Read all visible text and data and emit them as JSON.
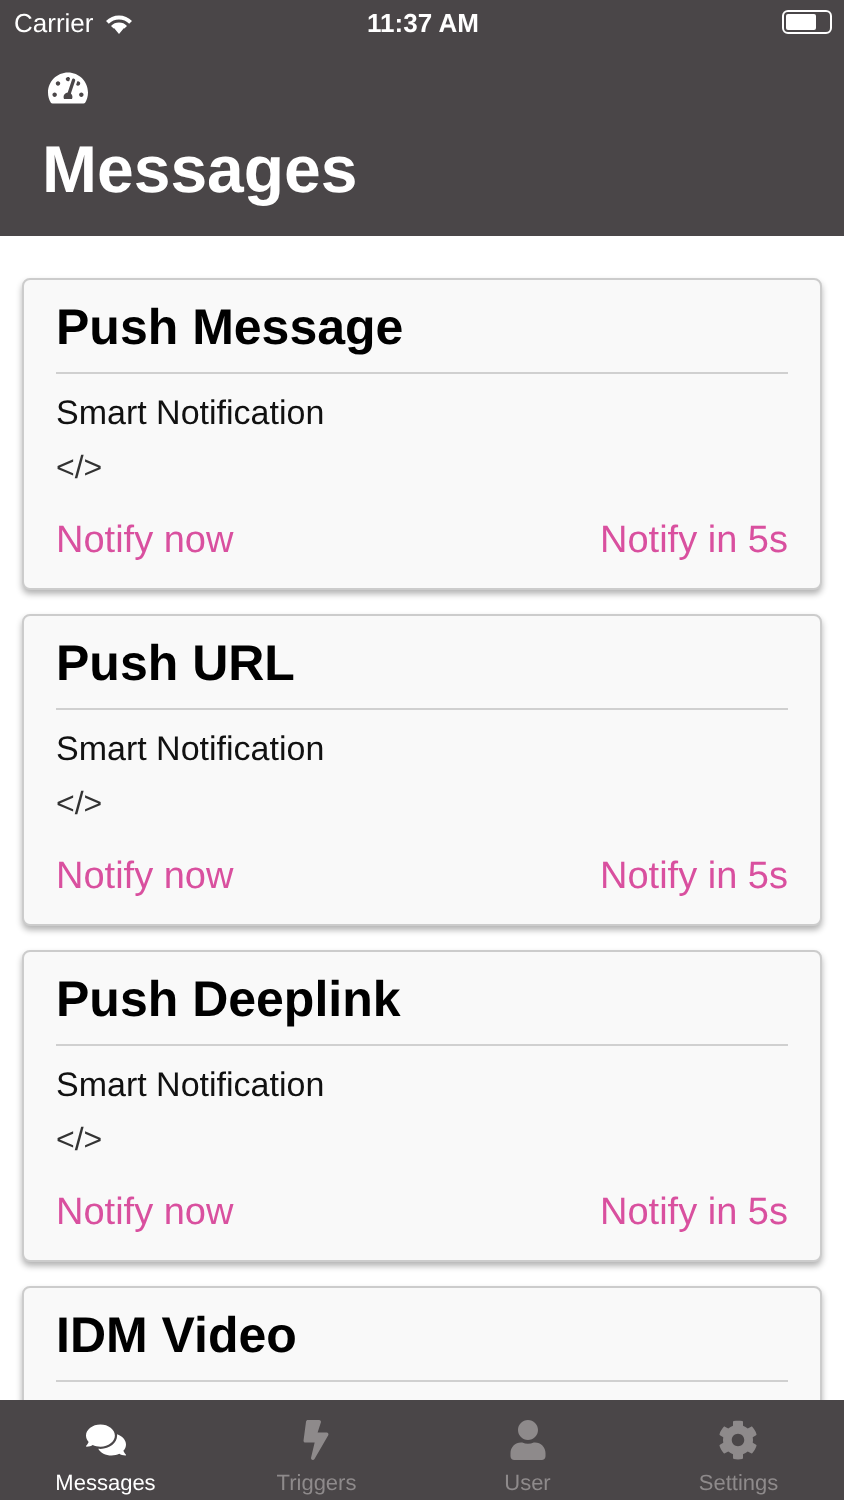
{
  "status_bar": {
    "carrier": "Carrier",
    "time": "11:37 AM"
  },
  "header": {
    "title": "Messages"
  },
  "cards": [
    {
      "title": "Push Message",
      "subtitle": "Smart Notification",
      "code": "</>",
      "actions": [
        "Notify now",
        "Notify in 5s"
      ]
    },
    {
      "title": "Push URL",
      "subtitle": "Smart Notification",
      "code": "</>",
      "actions": [
        "Notify now",
        "Notify in 5s"
      ]
    },
    {
      "title": "Push Deeplink",
      "subtitle": "Smart Notification",
      "code": "</>",
      "actions": [
        "Notify now",
        "Notify in 5s"
      ]
    },
    {
      "title": "IDM Video"
    }
  ],
  "tab_bar": [
    {
      "kind": "messages",
      "label": "Messages",
      "selected": true
    },
    {
      "kind": "triggers",
      "label": "Triggers",
      "selected": false
    },
    {
      "kind": "user",
      "label": "User",
      "selected": false
    },
    {
      "kind": "settings",
      "label": "Settings",
      "selected": false
    }
  ]
}
